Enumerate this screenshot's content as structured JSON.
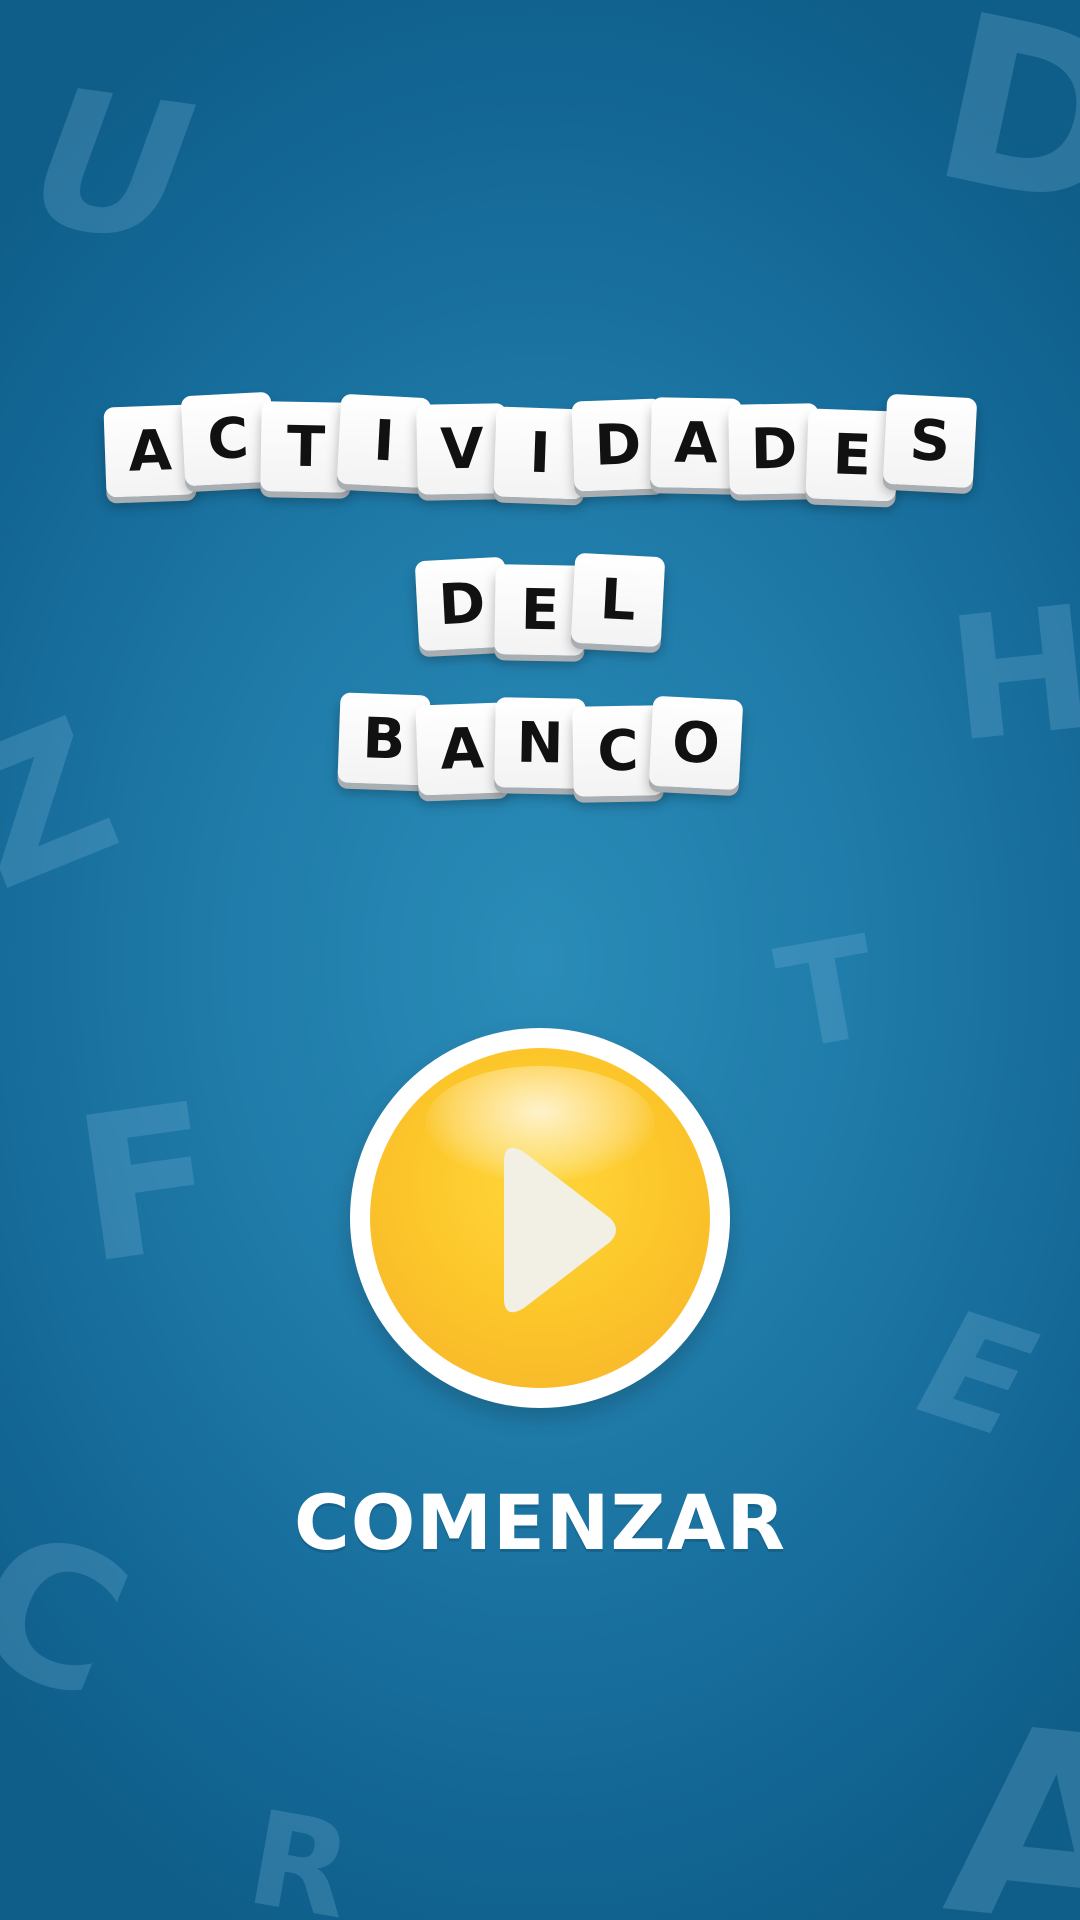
{
  "background_letters": [
    "U",
    "D",
    "H",
    "Z",
    "T",
    "F",
    "E",
    "C",
    "R",
    "A"
  ],
  "title": {
    "line1": [
      "A",
      "C",
      "T",
      "I",
      "V",
      "I",
      "D",
      "A",
      "D",
      "E",
      "S"
    ],
    "line2": [
      "D",
      "E",
      "L"
    ],
    "line3": [
      "B",
      "A",
      "N",
      "C",
      "O"
    ]
  },
  "play_button": {
    "icon": "play-icon",
    "color": "#fcc62a",
    "ring_color": "#ffffff"
  },
  "start_label": "COMENZAR",
  "colors": {
    "background": "#1f7aa8",
    "tile": "#ffffff",
    "tile_text": "#111111"
  }
}
